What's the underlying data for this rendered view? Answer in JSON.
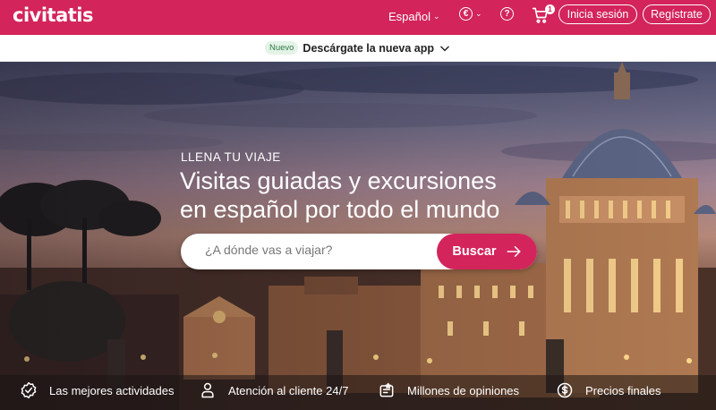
{
  "header": {
    "logo": "civitatis",
    "language": "Español",
    "currency_symbol": "€",
    "help_symbol": "?",
    "cart_count": "1",
    "login_label": "Inicia sesión",
    "register_label": "Regístrate"
  },
  "app_banner": {
    "badge": "Nuevo",
    "text": "Descárgate la nueva app"
  },
  "hero": {
    "eyebrow": "LLENA TU VIAJE",
    "headline_line1": "Visitas guiadas y excursiones",
    "headline_line2": "en español por todo el mundo",
    "search_placeholder": "¿A dónde vas a viajar?",
    "search_button": "Buscar"
  },
  "features": [
    {
      "icon": "badge-check-icon",
      "label": "Las mejores actividades"
    },
    {
      "icon": "support-agent-icon",
      "label": "Atención al cliente 24/7"
    },
    {
      "icon": "reviews-icon",
      "label": "Millones de opiniones"
    },
    {
      "icon": "dollar-icon",
      "label": "Precios finales"
    }
  ],
  "colors": {
    "brand": "#d3245b",
    "badge_bg": "#e3f3e8",
    "badge_text": "#2f7a46"
  }
}
